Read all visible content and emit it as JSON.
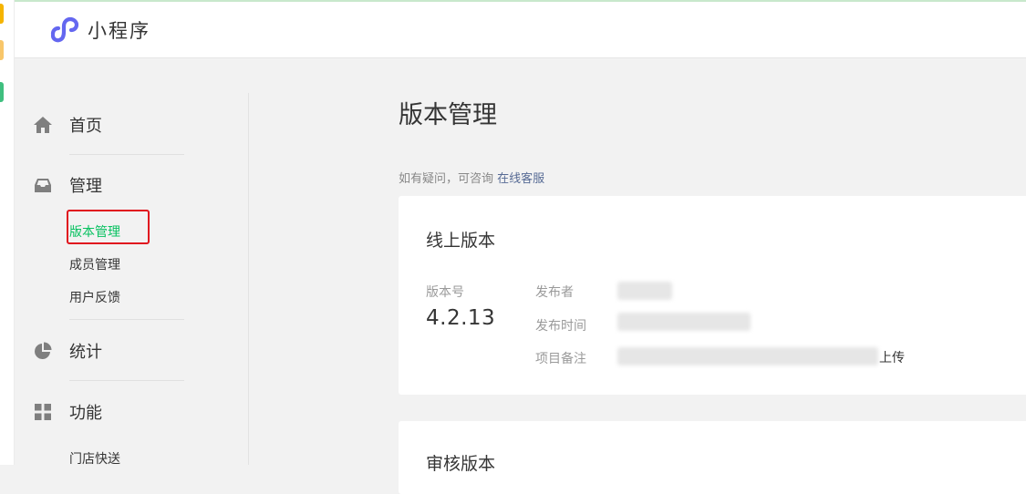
{
  "header": {
    "app_title": "小程序"
  },
  "sidebar": {
    "home": {
      "label": "首页",
      "icon": "home-icon"
    },
    "manage": {
      "label": "管理",
      "icon": "inbox-icon",
      "items": [
        {
          "label": "版本管理",
          "active": true
        },
        {
          "label": "成员管理",
          "active": false
        },
        {
          "label": "用户反馈",
          "active": false
        }
      ]
    },
    "stats": {
      "label": "统计",
      "icon": "pie-chart-icon"
    },
    "features": {
      "label": "功能",
      "icon": "grid-icon",
      "items": [
        {
          "label": "门店快送"
        }
      ]
    }
  },
  "main": {
    "title": "版本管理",
    "hint_prefix": "如有疑问，可咨询 ",
    "hint_link": "在线客服",
    "online_card": {
      "title": "线上版本",
      "version_label": "版本号",
      "version_value": "4.2.13",
      "publisher_label": "发布者",
      "publish_time_label": "发布时间",
      "note_label": "项目备注",
      "note_suffix": "上传"
    },
    "review_card": {
      "title": "审核版本"
    }
  },
  "colors": {
    "accent": "#07c160",
    "link": "#576b95",
    "highlight_box": "#e0141e",
    "logo": "#6467f0"
  }
}
